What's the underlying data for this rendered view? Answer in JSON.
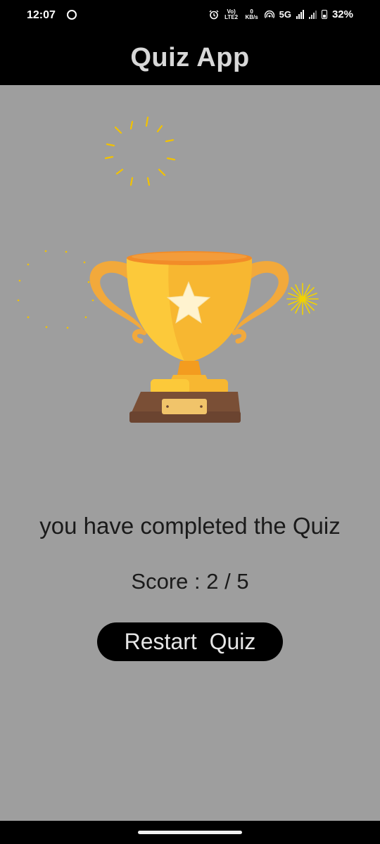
{
  "status_bar": {
    "time": "12:07",
    "volte_label": "Vo) LTE2",
    "speed_value": "0",
    "speed_unit": "KB/s",
    "network": "5G",
    "battery": "32%",
    "icons": [
      "alarm-icon",
      "hotspot-icon",
      "signal-icon",
      "battery-icon"
    ]
  },
  "app_bar": {
    "title": "Quiz App"
  },
  "result": {
    "message": "you have completed the Quiz",
    "score_text": "Score : 2 / 5",
    "restart_label": "Restart  Quiz"
  },
  "colors": {
    "background": "#9e9e9e",
    "app_bar": "#000000",
    "button": "#000000",
    "trophy_gold": "#f7b731"
  }
}
